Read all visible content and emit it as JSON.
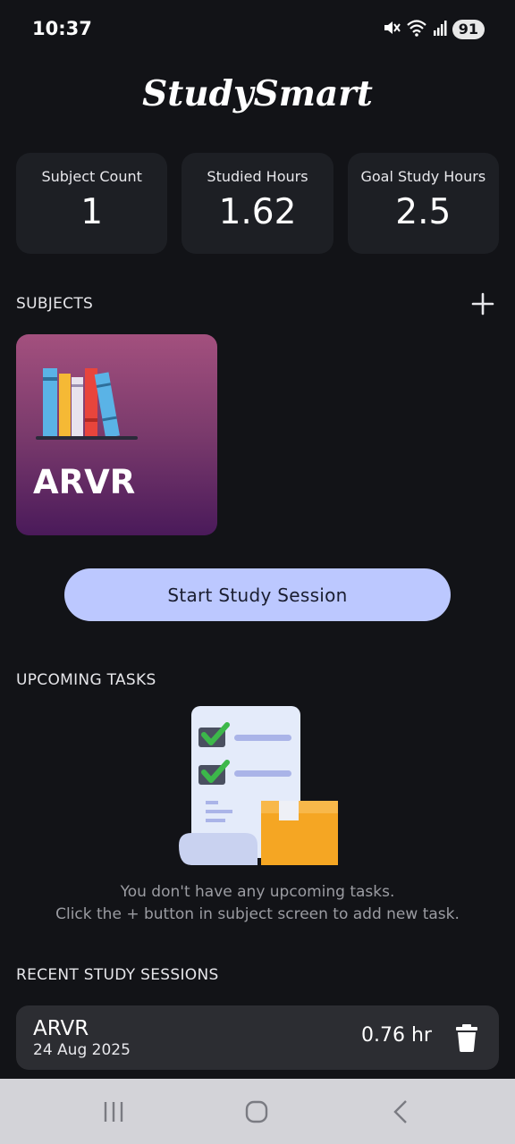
{
  "status_bar": {
    "time": "10:37",
    "battery": "91"
  },
  "app": {
    "title": "StudySmart"
  },
  "stats": [
    {
      "label": "Subject Count",
      "value": "1"
    },
    {
      "label": "Studied Hours",
      "value": "1.62"
    },
    {
      "label": "Goal Study Hours",
      "value": "2.5"
    }
  ],
  "subjects": {
    "header": "SUBJECTS",
    "items": [
      {
        "name": "ARVR",
        "gradient": [
          "#a3507e",
          "#4a1a5a"
        ]
      }
    ]
  },
  "start_session": {
    "label": "Start Study Session"
  },
  "upcoming_tasks": {
    "header": "UPCOMING TASKS",
    "empty_line1": "You don't have any upcoming tasks.",
    "empty_line2": "Click the + button in subject screen to add new task."
  },
  "recent_sessions": {
    "header": "RECENT STUDY SESSIONS",
    "items": [
      {
        "subject": "ARVR",
        "date": "24 Aug 2025",
        "duration": "0.76 hr"
      }
    ]
  },
  "icons": [
    "mute-icon",
    "wifi-icon",
    "signal-icon",
    "plus-icon",
    "books-icon",
    "tasks-illustration-icon",
    "trash-icon",
    "recents-icon",
    "home-icon",
    "back-icon"
  ],
  "colors": {
    "background": "#121317",
    "card": "#1d1f24",
    "accent_button": "#bcc8ff",
    "session_card": "#2c2d32"
  }
}
